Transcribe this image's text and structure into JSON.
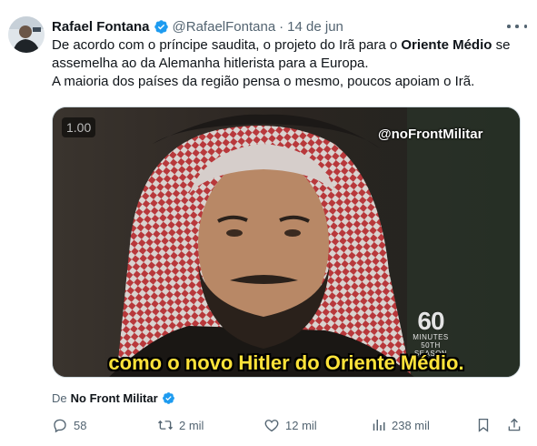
{
  "author": {
    "name": "Rafael Fontana",
    "handle": "@RafaelFontana",
    "separator": "·",
    "date": "14 de jun"
  },
  "tweet": {
    "p1_a": "De acordo com o príncipe saudita, o projeto do Irã para o ",
    "p1_bold": "Oriente Médio",
    "p1_b": " se assemelha ao da Alemanha hitlerista para a Europa.",
    "p2": "A maioria dos países da região pensa o mesmo, poucos apoiam o Irã."
  },
  "media": {
    "timer": "1.00",
    "watermark": "@noFrontMilitar",
    "logo_number": "60",
    "logo_text": "MINUTES",
    "logo_season": "50TH SEASON",
    "subtitle": "como o novo Hitler do Oriente Médio."
  },
  "source": {
    "prefix": "De",
    "name": "No Front Militar"
  },
  "actions": {
    "replies": "58",
    "reposts": "2 mil",
    "likes": "12 mil",
    "views": "238 mil"
  },
  "colors": {
    "verified": "#1d9bf0",
    "muted": "#536471",
    "subtitle": "#ffe33a"
  }
}
